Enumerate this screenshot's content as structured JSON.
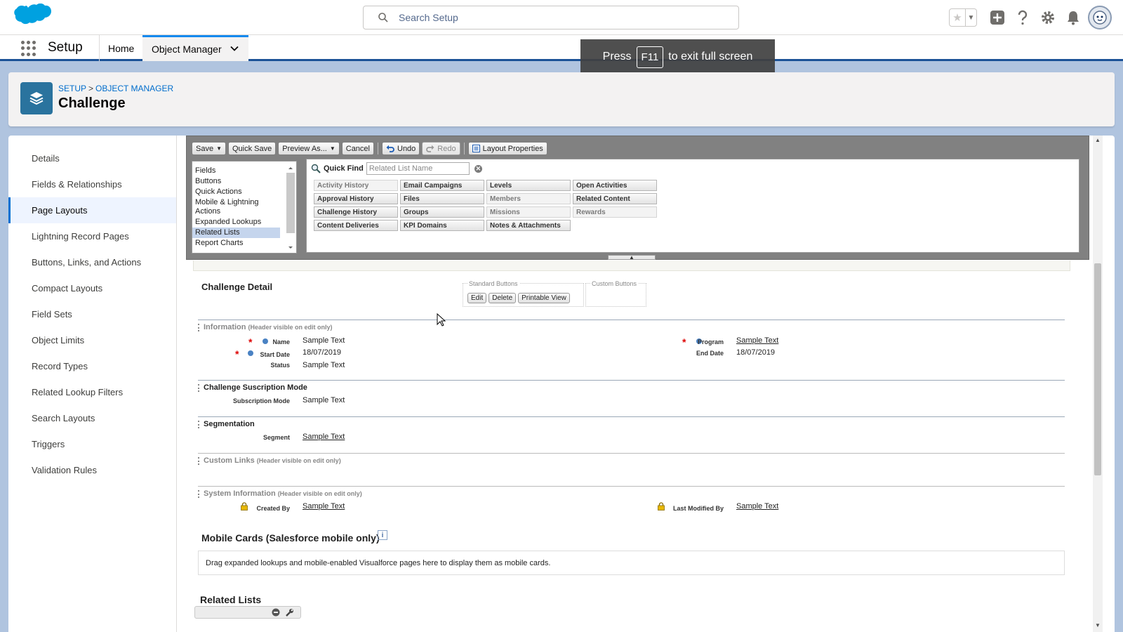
{
  "header": {
    "search_placeholder": "Search Setup"
  },
  "app_nav": {
    "app_name": "Setup",
    "tabs": [
      {
        "label": "Home"
      },
      {
        "label": "Object Manager"
      }
    ]
  },
  "overlay": {
    "press": "Press",
    "key": "F11",
    "rest": "to exit full screen"
  },
  "page_header": {
    "breadcrumb": [
      "SETUP",
      "OBJECT MANAGER"
    ],
    "breadcrumb_sep": ">",
    "title": "Challenge"
  },
  "left_nav": {
    "items": [
      {
        "label": "Details"
      },
      {
        "label": "Fields & Relationships"
      },
      {
        "label": "Page Layouts",
        "active": true
      },
      {
        "label": "Lightning Record Pages"
      },
      {
        "label": "Buttons, Links, and Actions"
      },
      {
        "label": "Compact Layouts"
      },
      {
        "label": "Field Sets"
      },
      {
        "label": "Object Limits"
      },
      {
        "label": "Record Types"
      },
      {
        "label": "Related Lookup Filters"
      },
      {
        "label": "Search Layouts"
      },
      {
        "label": "Triggers"
      },
      {
        "label": "Validation Rules"
      }
    ]
  },
  "toolbar": {
    "save": "Save",
    "quick_save": "Quick Save",
    "preview_as": "Preview As...",
    "cancel": "Cancel",
    "undo": "Undo",
    "redo": "Redo",
    "layout_properties": "Layout Properties"
  },
  "palette": {
    "categories": [
      "Fields",
      "Buttons",
      "Quick Actions",
      "Mobile & Lightning Actions",
      "Expanded Lookups",
      "Related Lists",
      "Report Charts"
    ],
    "selected_category": "Related Lists",
    "quick_find_label": "Quick Find",
    "quick_find_placeholder": "Related List Name",
    "items": [
      {
        "label": "Activity History",
        "used": true
      },
      {
        "label": "Email Campaigns",
        "used": false
      },
      {
        "label": "Levels",
        "used": false
      },
      {
        "label": "Open Activities",
        "used": false
      },
      {
        "label": "Approval History",
        "used": false
      },
      {
        "label": "Files",
        "used": false
      },
      {
        "label": "Members",
        "used": true
      },
      {
        "label": "Related Content",
        "used": false
      },
      {
        "label": "Challenge History",
        "used": false
      },
      {
        "label": "Groups",
        "used": false
      },
      {
        "label": "Missions",
        "used": true
      },
      {
        "label": "Rewards",
        "used": true
      },
      {
        "label": "Content Deliveries",
        "used": false
      },
      {
        "label": "KPI Domains",
        "used": false
      },
      {
        "label": "Notes & Attachments",
        "used": false
      }
    ]
  },
  "layout": {
    "detail_title": "Challenge Detail",
    "standard_buttons_label": "Standard Buttons",
    "custom_buttons_label": "Custom Buttons",
    "standard_buttons": [
      "Edit",
      "Delete",
      "Printable View"
    ],
    "sections": {
      "information": {
        "title": "Information",
        "note": "(Header visible on edit only)"
      },
      "subscription": {
        "title": "Challenge Suscription Mode"
      },
      "segmentation": {
        "title": "Segmentation"
      },
      "custom_links": {
        "title": "Custom Links",
        "note": "(Header visible on edit only)"
      },
      "system_info": {
        "title": "System Information",
        "note": "(Header visible on edit only)"
      }
    },
    "fields": {
      "name": {
        "label": "Name",
        "value": "Sample Text"
      },
      "start_date": {
        "label": "Start Date",
        "value": "18/07/2019"
      },
      "status": {
        "label": "Status",
        "value": "Sample Text"
      },
      "program": {
        "label": "Program",
        "value": "Sample Text"
      },
      "end_date": {
        "label": "End Date",
        "value": "18/07/2019"
      },
      "subscription_mode": {
        "label": "Subscription Mode",
        "value": "Sample Text"
      },
      "segment": {
        "label": "Segment",
        "value": "Sample Text"
      },
      "created_by": {
        "label": "Created By",
        "value": "Sample Text"
      },
      "last_modified_by": {
        "label": "Last Modified By",
        "value": "Sample Text"
      }
    },
    "mobile_cards_title": "Mobile Cards (Salesforce mobile only)",
    "mobile_cards_hint": "Drag expanded lookups and mobile-enabled Visualforce pages here to display them as mobile cards.",
    "related_lists_title": "Related Lists"
  },
  "colors": {
    "brand_blue": "#1b5297",
    "salesforce_cloud": "#00a1e0",
    "object_icon": "#2a739e",
    "active_nav": "#0070d2",
    "required": "#dd0000"
  }
}
